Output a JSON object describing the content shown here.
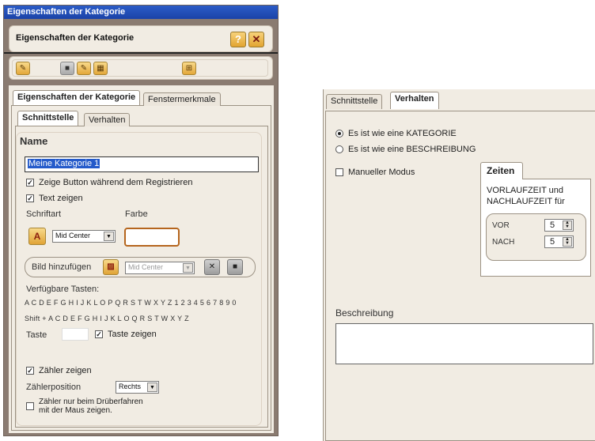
{
  "left_window": {
    "title": "Eigenschaften der Kategorie",
    "header_title": "Eigenschaften der Kategorie",
    "help_label": "?",
    "close_label": "✕",
    "tabs": [
      {
        "label": "Eigenschaften der Kategorie",
        "active": true
      },
      {
        "label": "Fenstermerkmale",
        "active": false
      }
    ],
    "subtabs": [
      {
        "label": "Schnittstelle",
        "active": true
      },
      {
        "label": "Verhalten",
        "active": false
      }
    ],
    "name_heading": "Name",
    "name_value": "Meine Kategorie 1",
    "cb_zeige_button": "Zeige Button während dem Registrieren",
    "cb_text_zeigen": "Text zeigen",
    "schriftart_label": "Schriftart",
    "farbe_label": "Farbe",
    "font_align_value": "Mid Center",
    "bild_label": "Bild hinzufügen",
    "bild_align_value": "Mid Center",
    "tasten_heading": "Verfügbare Tasten:",
    "tasten_line1": "A C D E F G H I J K L O P Q R S T W X Y Z 1 2 3 4 5 6 7 8 9 0",
    "tasten_line2": "Shift + A C D E F G H I J K L O Q R S T W X Y Z",
    "taste_label": "Taste",
    "cb_taste_zeigen": "Taste zeigen",
    "cb_zaehler_zeigen": "Zähler zeigen",
    "zaehlerposition_label": "Zählerposition",
    "zaehlerposition_value": "Rechts",
    "cb_zaehler_hover_line1": "Zähler nur beim Drüberfahren",
    "cb_zaehler_hover_line2": "mit der Maus zeigen."
  },
  "right_window": {
    "tabs": [
      {
        "label": "Schnittstelle",
        "active": false
      },
      {
        "label": "Verhalten",
        "active": true
      }
    ],
    "radio_kategorie": "Es ist wie eine KATEGORIE",
    "radio_beschreibung": "Es ist wie eine BESCHREIBUNG",
    "cb_manueller_modus": "Manueller Modus",
    "zeiten_tab": "Zeiten",
    "zeiten_text_line1": "VORLAUFZEIT und",
    "zeiten_text_line2": "NACHLAUFZEIT für",
    "vor_label": "VOR",
    "vor_value": "5",
    "nach_label": "NACH",
    "nach_value": "5",
    "beschreibung_label": "Beschreibung"
  },
  "colors": {
    "title_bar": "#1b43a8",
    "window_frame": "#8a7b71",
    "panel_bg": "#f1ece3",
    "selection": "#245aca",
    "accent_orange": "#e2a431"
  },
  "icons": [
    "help-icon",
    "close-icon",
    "edit-icon",
    "square-icon",
    "add-icon",
    "image-icon",
    "font-icon",
    "remove-image-icon",
    "clear-icon"
  ]
}
